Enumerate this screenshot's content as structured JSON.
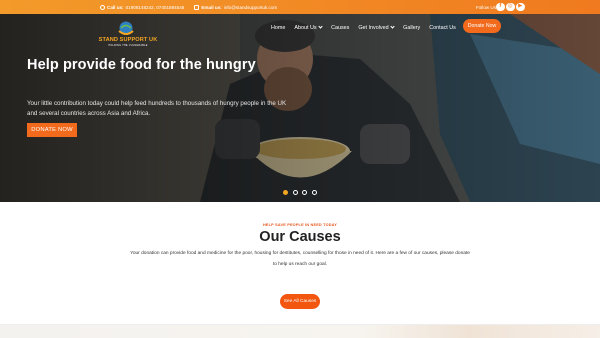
{
  "topbar": {
    "call_label": "Call us:",
    "call_value": "01908148242, 07401884546",
    "email_label": "Email us:",
    "email_value": "info@standsupportuk.com",
    "follow_label": "Follow Us",
    "social": [
      {
        "icon": "facebook-icon",
        "glyph": "f"
      },
      {
        "icon": "instagram-icon",
        "glyph": "◎"
      },
      {
        "icon": "youtube-icon",
        "glyph": "▶"
      }
    ]
  },
  "brand": {
    "name": "STAND SUPPORT UK",
    "tagline": "HOLDING THE VULNERABLE"
  },
  "nav": {
    "items": [
      {
        "label": "Home",
        "dropdown": false
      },
      {
        "label": "About Us",
        "dropdown": true
      },
      {
        "label": "Causes",
        "dropdown": false
      },
      {
        "label": "Get Involved",
        "dropdown": true
      },
      {
        "label": "Gallery",
        "dropdown": false
      },
      {
        "label": "Contact Us",
        "dropdown": false
      }
    ],
    "donate_label": "Donate Now"
  },
  "hero": {
    "title": "Help provide food for the hungry",
    "text": "Your little contribution today could help feed hundreds to thousands of hungry people in the UK and several countries across Asia and Africa.",
    "cta_label": "DONATE NOW",
    "slide_count": 4,
    "active_slide": 1
  },
  "causes": {
    "eyebrow": "HELP SAVE PEOPLE IN NEED TODAY",
    "title": "Our Causes",
    "text": "Your donation can provide food and medicine for the poor, housing for destitutes, counselling for those in need of it. Here are a few of our causes, please donate to help us reach our goal.",
    "button_label": "See All Causes"
  },
  "colors": {
    "accent": "#f26a1b",
    "topbar": "#f39a2a",
    "gold": "#f5a623"
  }
}
